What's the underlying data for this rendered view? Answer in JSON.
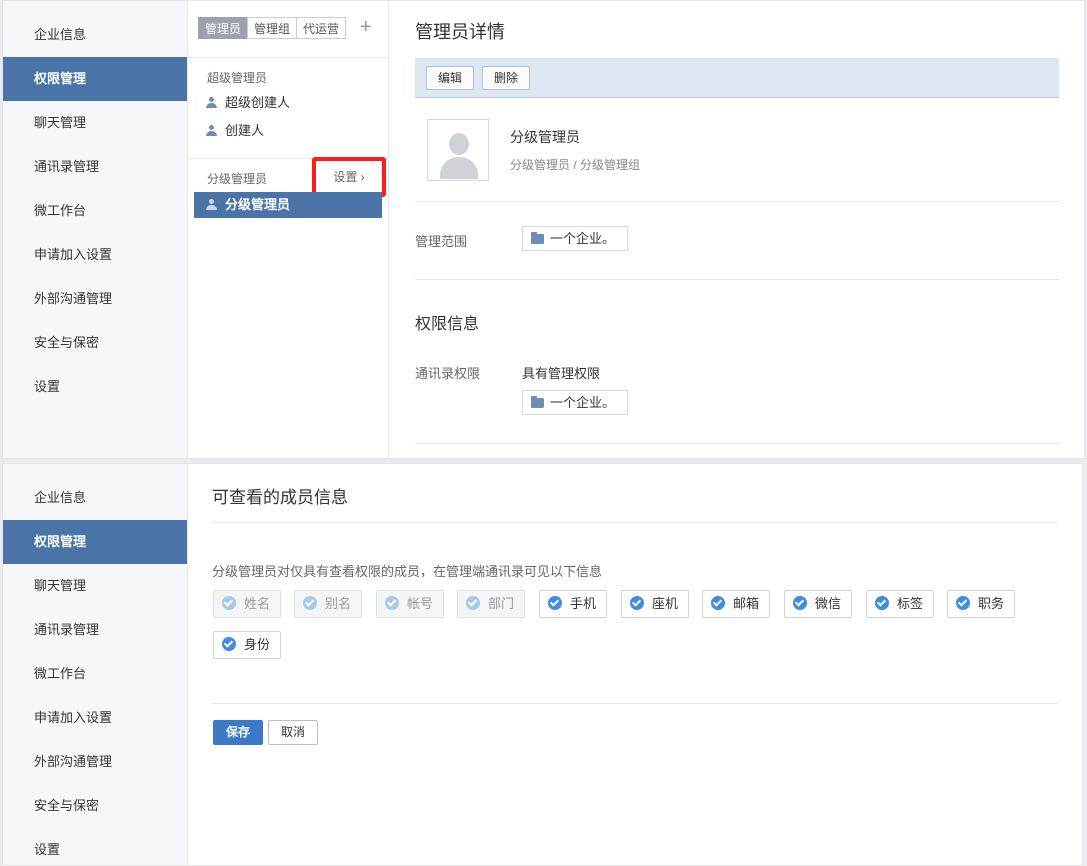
{
  "nav": {
    "items": [
      {
        "label": "企业信息",
        "active": false
      },
      {
        "label": "权限管理",
        "active": true
      },
      {
        "label": "聊天管理",
        "active": false
      },
      {
        "label": "通讯录管理",
        "active": false
      },
      {
        "label": "微工作台",
        "active": false
      },
      {
        "label": "申请加入设置",
        "active": false
      },
      {
        "label": "外部沟通管理",
        "active": false
      },
      {
        "label": "安全与保密",
        "active": false
      },
      {
        "label": "设置",
        "active": false
      }
    ]
  },
  "middle": {
    "tabs": [
      {
        "label": "管理员",
        "active": true
      },
      {
        "label": "管理组",
        "active": false
      },
      {
        "label": "代运营",
        "active": false
      }
    ],
    "plus": "+",
    "super_group_title": "超级管理员",
    "super_members": [
      "超级创建人",
      "创建人"
    ],
    "sub_group_title": "分级管理员",
    "settings_link": "设置 ›",
    "sub_members": [
      "分级管理员"
    ]
  },
  "detail": {
    "title": "管理员详情",
    "edit_label": "编辑",
    "delete_label": "删除",
    "admin_name": "分级管理员",
    "admin_role": "分级管理员 / 分级管理组",
    "scope_label": "管理范围",
    "scope_value": "一个企业。",
    "perm_title": "权限信息",
    "contacts_perm_label": "通讯录权限",
    "contacts_perm_value": "具有管理权限",
    "contacts_scope_value": "一个企业。"
  },
  "member_info": {
    "title": "可查看的成员信息",
    "description": "分级管理员对仅具有查看权限的成员，在管理端通讯录可见以下信息",
    "fields": [
      {
        "label": "姓名",
        "checked": true,
        "disabled": true
      },
      {
        "label": "别名",
        "checked": true,
        "disabled": true
      },
      {
        "label": "帐号",
        "checked": true,
        "disabled": true
      },
      {
        "label": "部门",
        "checked": true,
        "disabled": true
      },
      {
        "label": "手机",
        "checked": true,
        "disabled": false
      },
      {
        "label": "座机",
        "checked": true,
        "disabled": false
      },
      {
        "label": "邮箱",
        "checked": true,
        "disabled": false
      },
      {
        "label": "微信",
        "checked": true,
        "disabled": false
      },
      {
        "label": "标签",
        "checked": true,
        "disabled": false
      },
      {
        "label": "职务",
        "checked": true,
        "disabled": false
      },
      {
        "label": "身份",
        "checked": true,
        "disabled": false
      }
    ],
    "save_label": "保存",
    "cancel_label": "取消"
  },
  "colors": {
    "nav_active": "#4a74a8",
    "toolbar_bg": "#dde7f2",
    "check_blue": "#3f8de0",
    "save_blue": "#3a7ac7",
    "highlight_red": "#ff1c1c"
  }
}
